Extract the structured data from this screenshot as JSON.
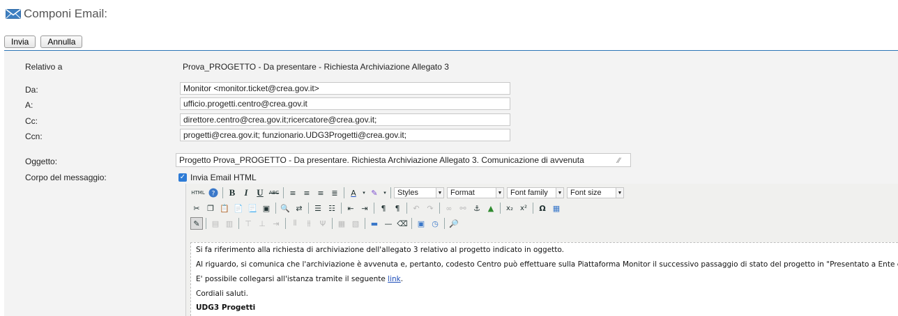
{
  "header": {
    "icon": "envelope-icon",
    "title": "Componi Email:"
  },
  "actions": {
    "send_label": "Invia",
    "cancel_label": "Annulla"
  },
  "form": {
    "related_label": "Relativo a",
    "related_value": "Prova_PROGETTO - Da presentare - Richiesta Archiviazione Allegato 3",
    "from_label": "Da:",
    "from_value": "Monitor  <monitor.ticket@crea.gov.it>",
    "to_label": "A:",
    "to_value": "ufficio.progetti.centro@crea.gov.it",
    "cc_label": "Cc:",
    "cc_value": "direttore.centro@crea.gov.it;ricercatore@crea.gov.it;",
    "bcc_label": "Ccn:",
    "bcc_value": "progetti@crea.gov.it; funzionario.UDG3Progetti@crea.gov.it;",
    "subject_label": "Oggetto:",
    "subject_value": "Progetto Prova_PROGETTO - Da presentare. Richiesta Archiviazione Allegato 3. Comunicazione di avvenuta",
    "body_label": "Corpo del messaggio:",
    "html_checkbox_label": "Invia Email HTML",
    "html_checkbox_checked": true
  },
  "toolbar": {
    "styles_label": "Styles",
    "format_label": "Format",
    "font_family_label": "Font family",
    "font_size_label": "Font size",
    "html_button_label": "HTML",
    "bold_label": "B",
    "italic_label": "I",
    "underline_label": "U",
    "strike_label": "ABC",
    "subscript_label": "x₂",
    "superscript_label": "x²",
    "omega_label": "Ω"
  },
  "body": {
    "line1": "Si fa riferimento alla richiesta di archiviazione dell'allegato 3 relativo al progetto indicato in oggetto.",
    "line2": "Al riguardo, si comunica che l'archiviazione è avvenuta e, pertanto, codesto Centro può effettuare sulla Piattaforma Monitor il successivo passaggio di stato del progetto in \"Presentato a Ente erogatore\".",
    "line3_prefix": " E' possibile collegarsi all'istanza tramite il seguente ",
    "line3_link": "link",
    "line3_suffix": ".",
    "line4": "Cordiali saluti.",
    "signature": "UDG3 Progetti"
  },
  "colors": {
    "accent_rule": "#2a74b5",
    "panel_bg": "#f3f3f3",
    "checkbox": "#2d7bd6",
    "link": "#1a4bb8"
  }
}
